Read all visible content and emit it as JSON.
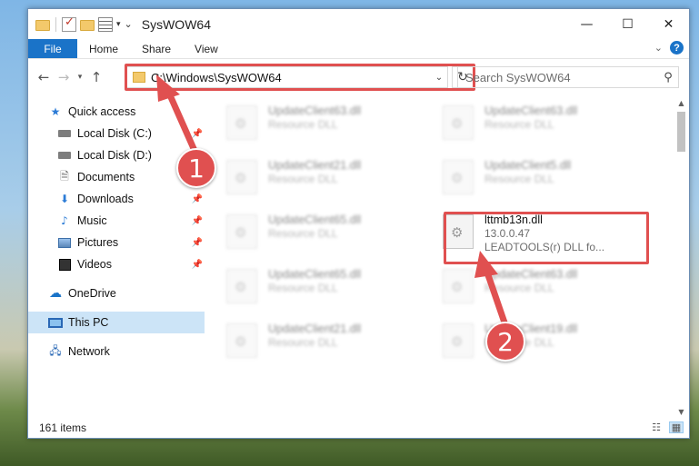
{
  "window": {
    "title": "SysWOW64",
    "controls": {
      "minimize": "—",
      "maximize": "☐",
      "close": "✕"
    }
  },
  "ribbon": {
    "tabs": [
      "File",
      "Home",
      "Share",
      "View"
    ],
    "collapse_icon": "chevron-down-icon",
    "help_label": "?"
  },
  "nav": {
    "back": "←",
    "forward": "→",
    "recent": "▾",
    "up": "↑",
    "address": "C:\\Windows\\SysWOW64",
    "search_placeholder": "Search SysWOW64"
  },
  "sidebar": {
    "items": [
      {
        "label": "Quick access",
        "icon": "star-icon"
      },
      {
        "label": "Local Disk (C:)",
        "icon": "disk-icon",
        "pinned": true
      },
      {
        "label": "Local Disk (D:)",
        "icon": "disk-icon"
      },
      {
        "label": "Documents",
        "icon": "documents-icon"
      },
      {
        "label": "Downloads",
        "icon": "download-icon",
        "pinned": true
      },
      {
        "label": "Music",
        "icon": "music-icon",
        "pinned": true
      },
      {
        "label": "Pictures",
        "icon": "pictures-icon",
        "pinned": true
      },
      {
        "label": "Videos",
        "icon": "videos-icon",
        "pinned": true
      },
      {
        "label": "OneDrive",
        "icon": "cloud-icon"
      },
      {
        "label": "This PC",
        "icon": "computer-icon",
        "selected": true
      },
      {
        "label": "Network",
        "icon": "network-icon"
      }
    ]
  },
  "files": [
    {
      "name": "UpdateClient63.dll",
      "desc": "Resource DLL"
    },
    {
      "name": "UpdateClient63.dll",
      "desc": "Resource DLL"
    },
    {
      "name": "UpdateClient21.dll",
      "desc": "Resource DLL"
    },
    {
      "name": "UpdateClient5.dll",
      "desc": "Resource DLL"
    },
    {
      "name": "UpdateClient65.dll",
      "desc": "Resource DLL"
    },
    {
      "name": "lttmb13n.dll",
      "version": "13.0.0.47",
      "desc": "LEADTOOLS(r) DLL fo..."
    },
    {
      "name": "UpdateClient65.dll",
      "desc": "Resource DLL"
    },
    {
      "name": "UpdateClient63.dll",
      "desc": "Resource DLL"
    },
    {
      "name": "UpdateClient21.dll",
      "desc": "Resource DLL"
    },
    {
      "name": "UpdateClient19.dll",
      "desc": "Resource DLL"
    }
  ],
  "status": {
    "count": "161 items"
  },
  "callouts": {
    "step1": "1",
    "step2": "2"
  },
  "colors": {
    "accent": "#1a73c8",
    "highlight": "#e05050",
    "selected": "#cce4f7"
  }
}
